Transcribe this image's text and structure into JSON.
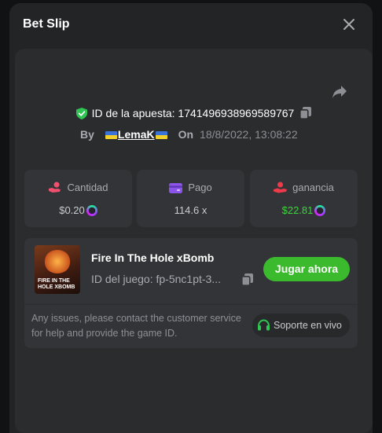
{
  "modal": {
    "title": "Bet Slip"
  },
  "bet": {
    "id_label": "ID de la apuesta:",
    "id_value": "1741496938969589767",
    "by_label": "By",
    "username": "LemaK",
    "on_label": "On",
    "datetime": "18/8/2022, 13:08:22"
  },
  "stats": [
    {
      "label": "Cantidad",
      "value": "$0.20",
      "icon": "coins-hand-icon",
      "currency_icon": "solana-coin-icon"
    },
    {
      "label": "Pago",
      "value": "114.6 x",
      "icon": "wallet-card-icon"
    },
    {
      "label": "ganancia",
      "value": "$22.81",
      "icon": "profit-hand-icon",
      "currency_icon": "solana-coin-icon"
    }
  ],
  "game": {
    "name": "Fire In The Hole xBomb",
    "id_text": "ID del juego: fp-5nc1pt-3...",
    "play_label": "Jugar ahora",
    "thumb_text": "FIRE IN THE HOLE XBOMB"
  },
  "support": {
    "text": "Any issues, please contact the customer service for help and provide the game ID.",
    "button_label": "Soporte en vivo"
  },
  "colors": {
    "accent_green": "#3cba2e",
    "win_green": "#3cd53c",
    "shield_green": "#2fc653",
    "panel": "#232426"
  }
}
